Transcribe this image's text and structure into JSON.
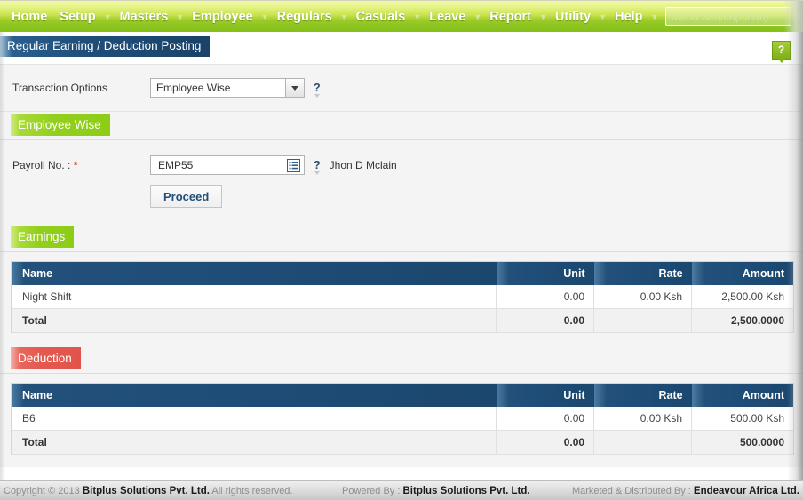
{
  "menu": {
    "items": [
      {
        "label": "Home",
        "has_caret": false
      },
      {
        "label": "Setup",
        "has_caret": true
      },
      {
        "label": "Masters",
        "has_caret": true
      },
      {
        "label": "Employee",
        "has_caret": true
      },
      {
        "label": "Regulars",
        "has_caret": true
      },
      {
        "label": "Casuals",
        "has_caret": true
      },
      {
        "label": "Leave",
        "has_caret": true
      },
      {
        "label": "Report",
        "has_caret": true
      },
      {
        "label": "Utility",
        "has_caret": true
      },
      {
        "label": "Help",
        "has_caret": true
      }
    ],
    "search_placeholder": "Menu Search(alt+m)",
    "search_value": "",
    "search_icon": "search-icon"
  },
  "page": {
    "title": "Regular Earning / Deduction Posting",
    "help_badge": "?",
    "accent_navy": "#1f4e79",
    "accent_green": "#8dcd16",
    "accent_red": "#e2544a"
  },
  "transaction": {
    "label": "Transaction Options",
    "selected": "Employee Wise",
    "options": [
      "Employee Wise"
    ],
    "help": "?"
  },
  "employee_wise": {
    "section_label": "Employee Wise",
    "payroll_label": "Payroll No. :",
    "required_mark": "*",
    "payroll_value": "EMP55",
    "payroll_placeholder": "",
    "lookup_icon": "list-lookup-icon",
    "help": "?",
    "employee_name": "Jhon D Mclain",
    "proceed_label": "Proceed"
  },
  "earnings": {
    "section_label": "Earnings",
    "columns": [
      "Name",
      "Unit",
      "Rate",
      "Amount"
    ],
    "rows": [
      {
        "name": "Night Shift",
        "unit": "0.00",
        "rate": "0.00 Ksh",
        "amount": "2,500.00 Ksh"
      }
    ],
    "total": {
      "name": "Total",
      "unit": "0.00",
      "rate": "",
      "amount": "2,500.0000"
    }
  },
  "deduction": {
    "section_label": "Deduction",
    "columns": [
      "Name",
      "Unit",
      "Rate",
      "Amount"
    ],
    "rows": [
      {
        "name": "B6",
        "unit": "0.00",
        "rate": "0.00 Ksh",
        "amount": "500.00 Ksh"
      }
    ],
    "total": {
      "name": "Total",
      "unit": "0.00",
      "rate": "",
      "amount": "500.0000"
    }
  },
  "footer": {
    "copyright_prefix": "Copyright © 2013",
    "copyright_company": "Bitplus Solutions Pvt. Ltd.",
    "copyright_suffix": "All rights reserved.",
    "powered_prefix": "Powered By :",
    "powered_company": "Bitplus Solutions Pvt. Ltd.",
    "marketed_prefix": "Marketed & Distributed By :",
    "marketed_company": "Endeavour Africa Ltd."
  }
}
